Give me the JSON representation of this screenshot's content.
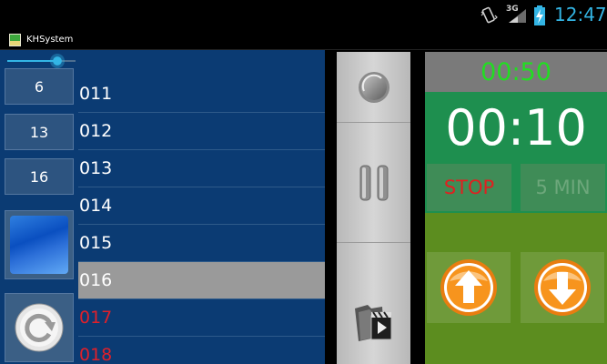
{
  "status_bar": {
    "network": "3G",
    "time": "12:47",
    "icons": [
      "vibrate-icon",
      "signal-icon",
      "battery-charging-icon"
    ],
    "accent": "#33b5e5"
  },
  "app": {
    "title": "KHSystem",
    "icon": "app-icon"
  },
  "left_panel": {
    "slider_value": 0.73,
    "number_buttons": [
      "6",
      "13",
      "16"
    ],
    "song_list": [
      {
        "label": "011",
        "state": "normal"
      },
      {
        "label": "012",
        "state": "normal"
      },
      {
        "label": "013",
        "state": "normal"
      },
      {
        "label": "014",
        "state": "normal"
      },
      {
        "label": "015",
        "state": "normal"
      },
      {
        "label": "016",
        "state": "selected"
      },
      {
        "label": "017",
        "state": "red"
      },
      {
        "label": "018",
        "state": "red"
      }
    ],
    "colors": {
      "background": "#0b3b73",
      "selected": "#9a9a9a",
      "red": "#e0202a"
    }
  },
  "middle_controls": {
    "icons": [
      "record-button-icon",
      "pause-icon",
      "video-folder-icon"
    ]
  },
  "timer_panel": {
    "secondary_time": "00:50",
    "main_time": "00:10",
    "stop_label": "STOP",
    "five_min_label": "5 MIN",
    "up_icon": "arrow-up-icon",
    "down_icon": "arrow-down-icon",
    "colors": {
      "secondary_time": "#22dd22",
      "panel": "#1e8f4f",
      "arrows": "#5c8d1f",
      "stop": "#e02020"
    }
  }
}
